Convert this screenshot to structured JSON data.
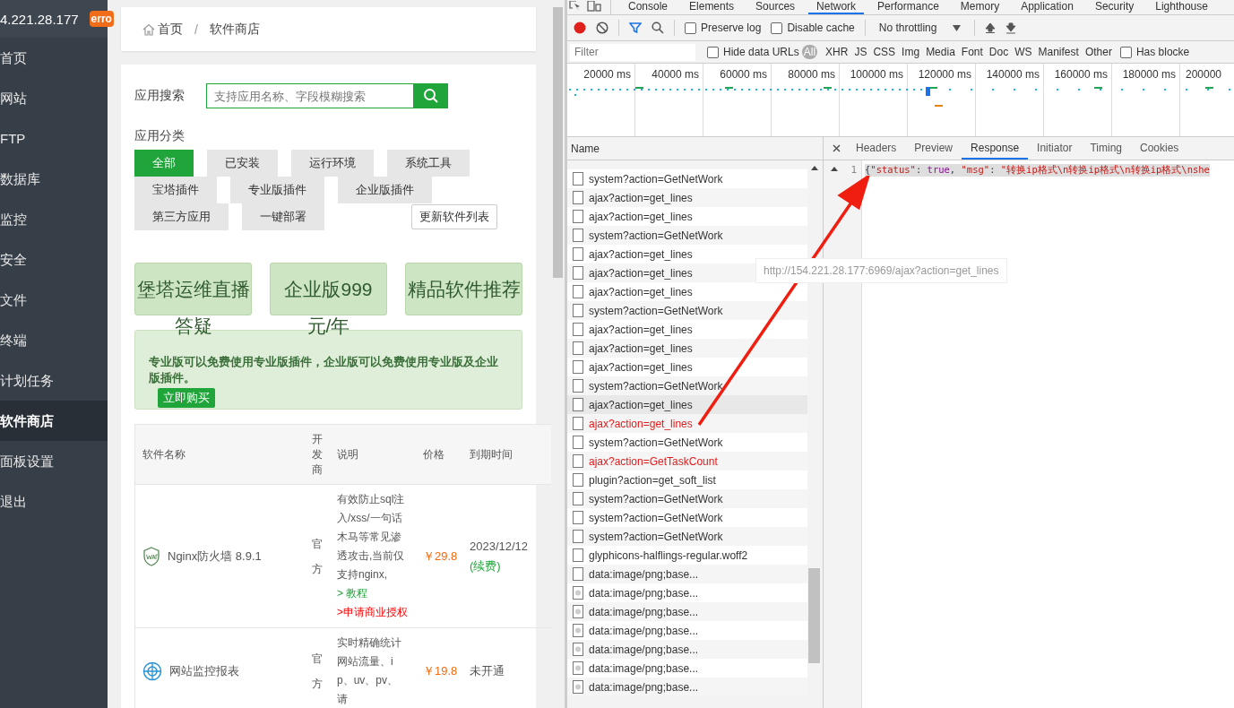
{
  "sidebar": {
    "host": "4.221.28.177",
    "badge": "erro",
    "items": [
      {
        "label": "首页",
        "selected": false
      },
      {
        "label": "网站",
        "selected": false
      },
      {
        "label": "FTP",
        "selected": false
      },
      {
        "label": "数据库",
        "selected": false
      },
      {
        "label": "监控",
        "selected": false
      },
      {
        "label": "安全",
        "selected": false
      },
      {
        "label": "文件",
        "selected": false
      },
      {
        "label": "终端",
        "selected": false
      },
      {
        "label": "计划任务",
        "selected": false
      },
      {
        "label": "软件商店",
        "selected": true
      },
      {
        "label": "面板设置",
        "selected": false
      },
      {
        "label": "退出",
        "selected": false
      }
    ]
  },
  "breadcrumb": {
    "items": [
      "首页",
      "软件商店"
    ],
    "separator": "/"
  },
  "search": {
    "label": "应用搜索",
    "placeholder": "支持应用名称、字段模糊搜索"
  },
  "categories": {
    "label": "应用分类",
    "tags": [
      {
        "label": "全部",
        "selected": true
      },
      {
        "label": "已安装",
        "selected": false
      },
      {
        "label": "运行环境",
        "selected": false
      },
      {
        "label": "系统工具",
        "selected": false
      },
      {
        "label": "宝塔插件",
        "selected": false
      },
      {
        "label": "专业版插件",
        "selected": false
      },
      {
        "label": "企业版插件",
        "selected": false
      },
      {
        "label": "第三方应用",
        "selected": false
      },
      {
        "label": "一键部署",
        "selected": false
      }
    ],
    "update_button": "更新软件列表"
  },
  "banners": [
    {
      "title": "堡塔运维直播",
      "overflow": "答疑"
    },
    {
      "title": "企业版999",
      "overflow": "元/年"
    },
    {
      "title": "精品软件推荐"
    }
  ],
  "promo": {
    "text": "专业版可以免费使用专业版插件，企业版可以免费使用专业版及企业版插件。",
    "button": "立即购买"
  },
  "table": {
    "columns": [
      "软件名称",
      "开发商",
      "说明",
      "价格",
      "到期时间"
    ],
    "rows": [
      {
        "name": "Nginx防火墙 8.9.1",
        "developer": "官方",
        "description": [
          {
            "kind": "text",
            "text": "有效防止sql注入/xss/一句话木马等常见渗透攻击,当前仅支持nginx, "
          },
          {
            "kind": "tutorial",
            "text": "> 教程"
          },
          {
            "kind": "apply",
            "text": " >申请商业授权"
          }
        ],
        "price": "￥29.8",
        "expiry": "2023/12/12",
        "renew": "(续费)"
      },
      {
        "name": "网站监控报表",
        "developer": "官方",
        "description": [
          {
            "kind": "text",
            "text": "实时精确统计网站流量、ip、uv、pv、请"
          }
        ],
        "price": "￥19.8",
        "expiry": "未开通"
      }
    ]
  },
  "devtools": {
    "tabs": [
      {
        "label": "Console",
        "selected": false
      },
      {
        "label": "Elements",
        "selected": false
      },
      {
        "label": "Sources",
        "selected": false
      },
      {
        "label": "Network",
        "selected": true
      },
      {
        "label": "Performance",
        "selected": false
      },
      {
        "label": "Memory",
        "selected": false
      },
      {
        "label": "Application",
        "selected": false
      },
      {
        "label": "Security",
        "selected": false
      },
      {
        "label": "Lighthouse",
        "selected": false
      }
    ],
    "preserve_log": {
      "label": "Preserve log",
      "checked": false
    },
    "disable_cache": {
      "label": "Disable cache",
      "checked": false
    },
    "throttling": "No throttling",
    "filter_placeholder": "Filter",
    "hide_data_urls": {
      "label": "Hide data URLs",
      "checked": false
    },
    "types": [
      {
        "label": "All",
        "selected": true
      },
      {
        "label": "XHR",
        "selected": false
      },
      {
        "label": "JS",
        "selected": false
      },
      {
        "label": "CSS",
        "selected": false
      },
      {
        "label": "Img",
        "selected": false
      },
      {
        "label": "Media",
        "selected": false
      },
      {
        "label": "Font",
        "selected": false
      },
      {
        "label": "Doc",
        "selected": false
      },
      {
        "label": "WS",
        "selected": false
      },
      {
        "label": "Manifest",
        "selected": false
      },
      {
        "label": "Other",
        "selected": false
      }
    ],
    "has_blocked": {
      "label": "Has blocke",
      "checked": false
    },
    "ticks": [
      "20000 ms",
      "40000 ms",
      "60000 ms",
      "80000 ms",
      "100000 ms",
      "120000 ms",
      "140000 ms",
      "160000 ms",
      "180000 ms",
      "200000"
    ],
    "name_column": "Name",
    "requests": [
      {
        "name": "system?action=GetNetWork",
        "kind": "doc",
        "error": false,
        "selected": false
      },
      {
        "name": "ajax?action=get_lines",
        "kind": "doc",
        "error": false,
        "selected": false
      },
      {
        "name": "ajax?action=get_lines",
        "kind": "doc",
        "error": false,
        "selected": false
      },
      {
        "name": "system?action=GetNetWork",
        "kind": "doc",
        "error": false,
        "selected": false
      },
      {
        "name": "ajax?action=get_lines",
        "kind": "doc",
        "error": false,
        "selected": false
      },
      {
        "name": "ajax?action=get_lines",
        "kind": "doc",
        "error": false,
        "selected": false
      },
      {
        "name": "ajax?action=get_lines",
        "kind": "doc",
        "error": false,
        "selected": false
      },
      {
        "name": "system?action=GetNetWork",
        "kind": "doc",
        "error": false,
        "selected": false
      },
      {
        "name": "ajax?action=get_lines",
        "kind": "doc",
        "error": false,
        "selected": false
      },
      {
        "name": "ajax?action=get_lines",
        "kind": "doc",
        "error": false,
        "selected": false
      },
      {
        "name": "ajax?action=get_lines",
        "kind": "doc",
        "error": false,
        "selected": false
      },
      {
        "name": "system?action=GetNetWork",
        "kind": "doc",
        "error": false,
        "selected": false
      },
      {
        "name": "ajax?action=get_lines",
        "kind": "doc",
        "error": false,
        "selected": true
      },
      {
        "name": "ajax?action=get_lines",
        "kind": "doc",
        "error": true,
        "selected": false
      },
      {
        "name": "system?action=GetNetWork",
        "kind": "doc",
        "error": false,
        "selected": false
      },
      {
        "name": "ajax?action=GetTaskCount",
        "kind": "doc",
        "error": true,
        "selected": false
      },
      {
        "name": "plugin?action=get_soft_list",
        "kind": "doc",
        "error": false,
        "selected": false
      },
      {
        "name": "system?action=GetNetWork",
        "kind": "doc",
        "error": false,
        "selected": false
      },
      {
        "name": "system?action=GetNetWork",
        "kind": "doc",
        "error": false,
        "selected": false
      },
      {
        "name": "system?action=GetNetWork",
        "kind": "doc",
        "error": false,
        "selected": false
      },
      {
        "name": "glyphicons-halflings-regular.woff2",
        "kind": "doc",
        "error": false,
        "selected": false
      },
      {
        "name": "data:image/png;base...",
        "kind": "doc",
        "error": false,
        "selected": false
      },
      {
        "name": "data:image/png;base...",
        "kind": "image",
        "error": false,
        "selected": false
      },
      {
        "name": "data:image/png;base...",
        "kind": "image",
        "error": false,
        "selected": false
      },
      {
        "name": "data:image/png;base...",
        "kind": "image",
        "error": false,
        "selected": false
      },
      {
        "name": "data:image/png;base...",
        "kind": "image",
        "error": false,
        "selected": false
      },
      {
        "name": "data:image/png;base...",
        "kind": "image",
        "error": false,
        "selected": false
      },
      {
        "name": "data:image/png;base...",
        "kind": "image",
        "error": false,
        "selected": false
      }
    ],
    "detail_tabs": [
      {
        "label": "Headers",
        "selected": false
      },
      {
        "label": "Preview",
        "selected": false
      },
      {
        "label": "Response",
        "selected": true
      },
      {
        "label": "Initiator",
        "selected": false
      },
      {
        "label": "Timing",
        "selected": false
      },
      {
        "label": "Cookies",
        "selected": false
      }
    ],
    "line_number": "1",
    "response": [
      {
        "kind": "punct",
        "text": "{"
      },
      {
        "kind": "key",
        "text": "\"status\""
      },
      {
        "kind": "punct",
        "text": ": "
      },
      {
        "kind": "bool",
        "text": "true"
      },
      {
        "kind": "punct",
        "text": ", "
      },
      {
        "kind": "key",
        "text": "\"msg\""
      },
      {
        "kind": "punct",
        "text": ": "
      },
      {
        "kind": "string",
        "text": "\"转换ip格式\\n转换ip格式\\n转换ip格式\\nshe"
      }
    ],
    "tooltip": "http://154.221.28.177:6969/ajax?action=get_lines"
  }
}
